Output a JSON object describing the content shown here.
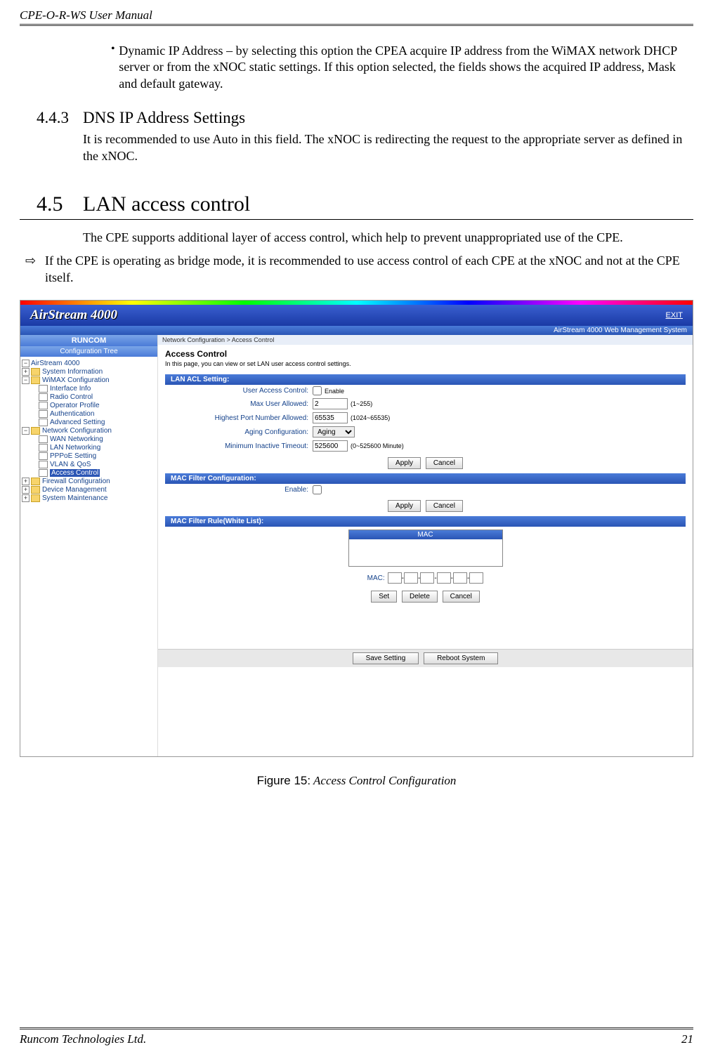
{
  "doc": {
    "header": "CPE-O-R-WS User Manual",
    "footer_left": "Runcom Technologies Ltd.",
    "footer_right": "21"
  },
  "bullet": {
    "text": "Dynamic IP Address – by selecting this option the CPEA acquire IP address from the WiMAX network DHCP server or from the xNOC static settings. If this option selected, the fields shows the acquired IP address, Mask and default gateway."
  },
  "s443": {
    "num": "4.4.3",
    "title": "DNS IP Address Settings",
    "body": "It is recommended to use Auto in this field. The xNOC is redirecting the request to the appropriate server as defined in the xNOC."
  },
  "s45": {
    "num": "4.5",
    "title": "LAN access control",
    "body1": "The CPE supports additional layer of access control, which help to prevent unappropriated use of the CPE.",
    "arrow": "If the CPE is operating as bridge mode, it is recommended to use access control of each CPE at the xNOC and not at the CPE itself."
  },
  "shot": {
    "brand": "AirStream 4000",
    "exit": "EXIT",
    "subbar": "AirStream 4000 Web Management System",
    "runcom": "RUNCOM",
    "tree_head": "Configuration Tree",
    "tree": {
      "root": "AirStream 4000",
      "n1": "System Information",
      "n2": "WiMAX Configuration",
      "n2a": "Interface Info",
      "n2b": "Radio Control",
      "n2c": "Operator Profile",
      "n2d": "Authentication",
      "n2e": "Advanced Setting",
      "n3": "Network Configuration",
      "n3a": "WAN Networking",
      "n3b": "LAN Networking",
      "n3c": "PPPoE Setting",
      "n3d": "VLAN & QoS",
      "n3e": "Access Control",
      "n4": "Firewall Configuration",
      "n5": "Device Management",
      "n6": "System Maintenance"
    },
    "crumb": "Network Configuration > Access Control",
    "h1": "Access Control",
    "sub": "In this page, you can view or set LAN user access control settings.",
    "sec1": "LAN ACL Setting:",
    "f1": {
      "label": "User Access Control:",
      "after": "Enable"
    },
    "f2": {
      "label": "Max User Allowed:",
      "val": "2",
      "after": "(1~255)"
    },
    "f3": {
      "label": "Highest Port Number Allowed:",
      "val": "65535",
      "after": "(1024~65535)"
    },
    "f4": {
      "label": "Aging Configuration:",
      "val": "Aging"
    },
    "f5": {
      "label": "Minimum Inactive Timeout:",
      "val": "525600",
      "after": "(0~525600 Minute)"
    },
    "apply": "Apply",
    "cancel": "Cancel",
    "sec2": "MAC Filter Configuration:",
    "f6": {
      "label": "Enable:"
    },
    "sec3": "MAC Filter Rule(White List):",
    "thead": "MAC",
    "maclabel": "MAC:",
    "set": "Set",
    "delete": "Delete",
    "save": "Save Setting",
    "reboot": "Reboot System"
  },
  "figure": {
    "label": "Figure 15:",
    "title": "  Access Control Configuration"
  }
}
